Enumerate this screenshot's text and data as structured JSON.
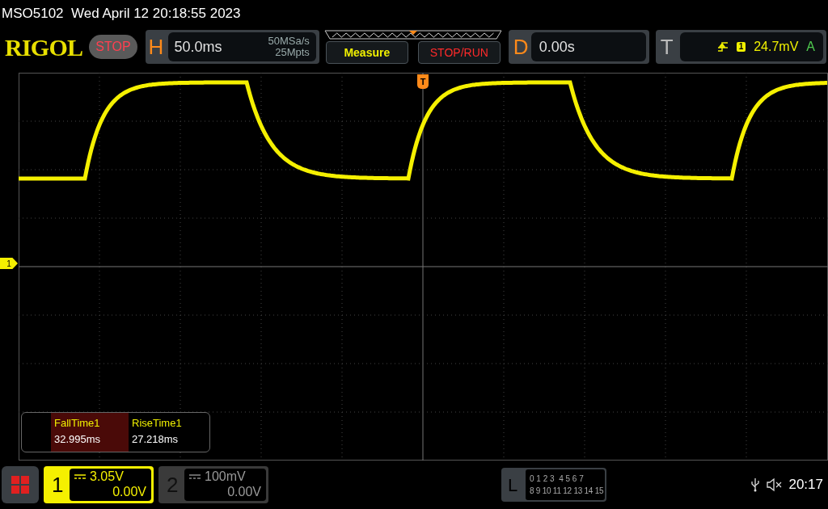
{
  "status_line": {
    "text": "MSO5102  Wed April 12 20:18:55 2023"
  },
  "toolbar": {
    "logo": "RIGOL",
    "run_state": "STOP",
    "horizontal": {
      "label": "H",
      "timebase": "50.0ms",
      "sample_rate": "50MSa/s",
      "memory_depth": "25Mpts"
    },
    "buttons": [
      "Measure",
      "STOP/RUN"
    ],
    "delay": {
      "label": "D",
      "value": "0.00s"
    },
    "trigger": {
      "label": "T",
      "source": "1",
      "level": "24.7mV",
      "mode": "A"
    }
  },
  "screen": {
    "trigger_marker": "T",
    "channel_marker": "1",
    "measurements": [
      {
        "name": "FallTime1",
        "value": "32.995ms"
      },
      {
        "name": "RiseTime1",
        "value": "27.218ms"
      }
    ]
  },
  "channels": [
    {
      "number": "1",
      "scale": "3.05V",
      "offset": "0.00V",
      "selected": true
    },
    {
      "number": "2",
      "scale": "100mV",
      "offset": "0.00V",
      "selected": false
    }
  ],
  "logic": {
    "label": "L",
    "row_1": "0 1 2 3  4 5 6 7",
    "row_2": "8 9 10 11 12 13 14 15"
  },
  "status": {
    "time": "20:17"
  }
}
